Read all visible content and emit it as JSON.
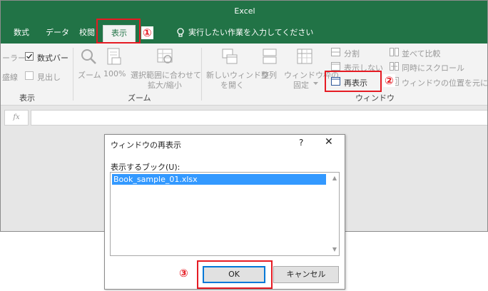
{
  "app": {
    "title": "Excel"
  },
  "tabs": [
    {
      "label": "数式"
    },
    {
      "label": "データ"
    },
    {
      "label": "校閲"
    },
    {
      "label": "表示"
    }
  ],
  "tell_me": {
    "text": "実行したい作業を入力してください"
  },
  "ribbon": {
    "show_group": {
      "ruler_label": "ーラー",
      "formula_bar_label": "数式バー",
      "formula_bar_checked": true,
      "gridlines_label": "盛線",
      "headings_label": "見出し",
      "headings_checked": false,
      "group_label": "表示"
    },
    "zoom_group": {
      "zoom_label": "ズーム",
      "hundred_label": "100%",
      "zoom_to_selection_line1": "選択範囲に合わせて",
      "zoom_to_selection_line2": "拡大/縮小",
      "group_label": "ズーム"
    },
    "window_group": {
      "new_window_line1": "新しいウィンドウ",
      "new_window_line2": "を開く",
      "arrange_label": "整列",
      "freeze_line1": "ウィンドウ枠の",
      "freeze_line2": "固定",
      "split_label": "分割",
      "hide_label": "表示しない",
      "unhide_label": "再表示",
      "side_by_side_label": "並べて比較",
      "sync_scroll_label": "同時にスクロール",
      "reset_position_label": "ウィンドウの位置を元に戻す",
      "group_label": "ウィンドウ"
    }
  },
  "formula_bar": {
    "fx_label": "fx"
  },
  "callouts": {
    "one": "①",
    "two": "②",
    "three": "③"
  },
  "dialog": {
    "title": "ウィンドウの再表示",
    "help": "?",
    "close": "✕",
    "label": "表示するブック(U):",
    "books": [
      "Book_sample_01.xlsx"
    ],
    "ok_label": "OK",
    "cancel_label": "キャンセル"
  },
  "colors": {
    "title_bar": "#217346",
    "callout": "#e51b23",
    "selection": "#3399ff"
  }
}
